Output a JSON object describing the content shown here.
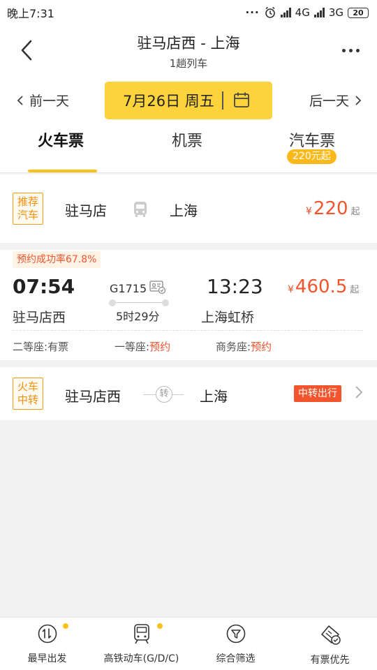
{
  "status_bar": {
    "time": "晚上7:31",
    "network1": "4G",
    "network2": "3G",
    "battery": "20"
  },
  "header": {
    "title": "驻马店西 - 上海",
    "subtitle": "1趟列车"
  },
  "date_bar": {
    "prev": "前一天",
    "date": "7月26日 周五",
    "next": "后一天"
  },
  "tabs": [
    {
      "label": "火车票",
      "active": true
    },
    {
      "label": "机票",
      "active": false
    },
    {
      "label": "汽车票",
      "active": false,
      "badge": "220元起"
    }
  ],
  "bus_card": {
    "tag": "推荐汽车",
    "tag_line1": "推荐",
    "tag_line2": "汽车",
    "from": "驻马店",
    "to": "上海",
    "yen": "¥",
    "price": "220",
    "suffix": "起"
  },
  "train_card": {
    "rate": "预约成功率67.8%",
    "depart_time": "07:54",
    "depart_station": "驻马店西",
    "train_no": "G1715",
    "duration": "5时29分",
    "arrive_time": "13:23",
    "arrive_station": "上海虹桥",
    "yen": "¥",
    "price": "460.5",
    "suffix": "起",
    "seats": [
      {
        "name": "二等座:",
        "status": "有票",
        "highlight": false
      },
      {
        "name": "一等座:",
        "status": "预约",
        "highlight": true
      },
      {
        "name": "商务座:",
        "status": "预约",
        "highlight": true
      }
    ]
  },
  "transfer_card": {
    "tag_line1": "火车",
    "tag_line2": "中转",
    "from": "驻马店西",
    "mid": "转",
    "to": "上海",
    "badge": "中转出行"
  },
  "bottom_nav": [
    {
      "label": "最早出发",
      "icon": "earliest-icon",
      "dot": true
    },
    {
      "label": "高铁动车(G/D/C)",
      "icon": "train-icon",
      "dot": true
    },
    {
      "label": "综合筛选",
      "icon": "filter-icon",
      "dot": false
    },
    {
      "label": "有票优先",
      "icon": "ticket-icon",
      "dot": false
    }
  ],
  "colors": {
    "accent": "#fcd33a",
    "price": "#f2542d",
    "tag": "#f1900f"
  }
}
